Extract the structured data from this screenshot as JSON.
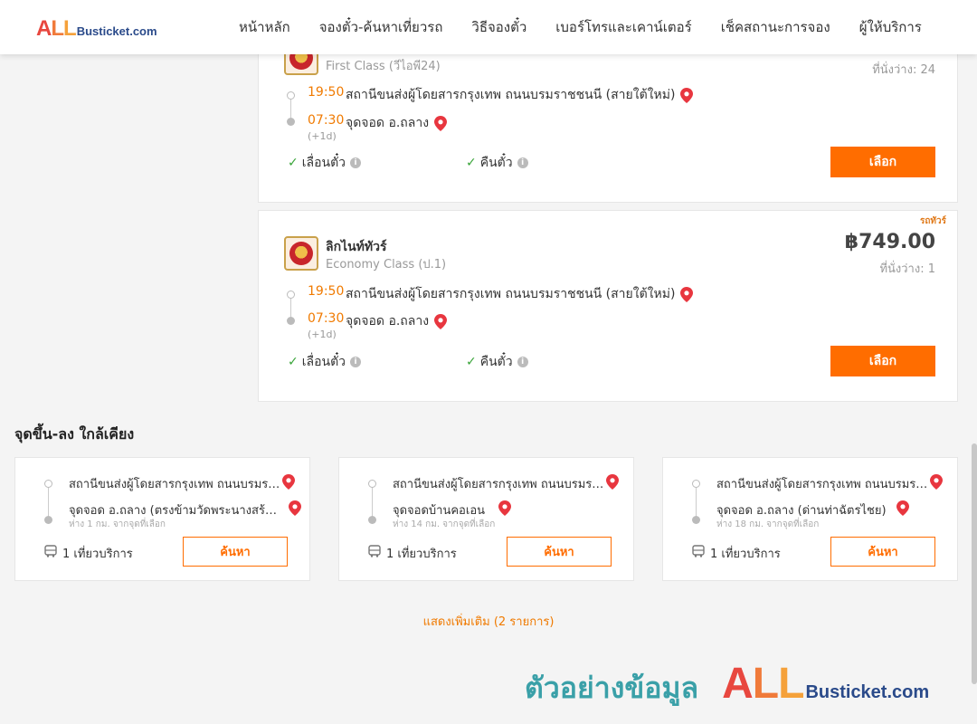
{
  "header": {
    "logo": {
      "all": "ALL",
      "rest": "Busticket.com"
    },
    "nav": [
      "หน้าหลัก",
      "จองตั๋ว-ค้นหาเที่ยวรถ",
      "วิธีจองตั๋ว",
      "เบอร์โทรและเคาน์เตอร์",
      "เช็คสถานะการจอง",
      "ผู้ให้บริการ"
    ]
  },
  "trips": [
    {
      "operator": "",
      "class": "First Class (วีไอพี24)",
      "price": "",
      "seats": "ที่นั่งว่าง: 24",
      "tag": "",
      "depart_time": "19:50",
      "depart_stop": "สถานีขนส่งผู้โดยสารกรุงเทพ ถนนบรมราชชนนี (สายใต้ใหม่)",
      "arrive_time": "07:30",
      "arrive_stop": "จุดจอด อ.ถลาง",
      "next_day": "(+1d)",
      "feature1": "เลื่อนตั๋ว",
      "feature2": "คืนตั๋ว",
      "select_label": "เลือก"
    },
    {
      "operator": "ลิกไนท์ทัวร์",
      "class": "Economy Class (ป.1)",
      "price": "฿749.00",
      "seats": "ที่นั่งว่าง: 1",
      "tag": "รถทัวร์",
      "depart_time": "19:50",
      "depart_stop": "สถานีขนส่งผู้โดยสารกรุงเทพ ถนนบรมราชชนนี (สายใต้ใหม่)",
      "arrive_time": "07:30",
      "arrive_stop": "จุดจอด อ.ถลาง",
      "next_day": "(+1d)",
      "feature1": "เลื่อนตั๋ว",
      "feature2": "คืนตั๋ว",
      "select_label": "เลือก"
    }
  ],
  "nearby": {
    "title": "จุดขึ้น-ลง ใกล้เคียง",
    "cards": [
      {
        "from": "สถานีขนส่งผู้โดยสารกรุงเทพ ถนนบรมราชชนนี (สายใต้ใหม่)",
        "to": "จุดจอด อ.ถลาง (ตรงข้ามวัดพระนางสร้าง)",
        "distance": "ห่าง 1 กม. จากจุดที่เลือก",
        "services": "1 เที่ยวบริการ",
        "search_label": "ค้นหา"
      },
      {
        "from": "สถานีขนส่งผู้โดยสารกรุงเทพ ถนนบรมราชชนนี (สายใต้ใหม่)",
        "to": "จุดจอดบ้านคอเอน",
        "distance": "ห่าง 14 กม. จากจุดที่เลือก",
        "services": "1 เที่ยวบริการ",
        "search_label": "ค้นหา"
      },
      {
        "from": "สถานีขนส่งผู้โดยสารกรุงเทพ ถนนบรมราชชนนี (สายใต้ใหม่)",
        "to": "จุดจอด อ.ถลาง (ด่านท่าฉัตรไชย)",
        "distance": "ห่าง 18 กม. จากจุดที่เลือก",
        "services": "1 เที่ยวบริการ",
        "search_label": "ค้นหา"
      }
    ],
    "show_more": "แสดงเพิ่มเติม (2 รายการ)"
  },
  "watermark": {
    "thai": "ตัวอย่างข้อมูล",
    "all": "ALL",
    "rest": "Busticket.com"
  },
  "colors": {
    "accent": "#ff6d00",
    "time": "#f07a00",
    "check": "#3aa53a",
    "pin": "#e8363f"
  }
}
